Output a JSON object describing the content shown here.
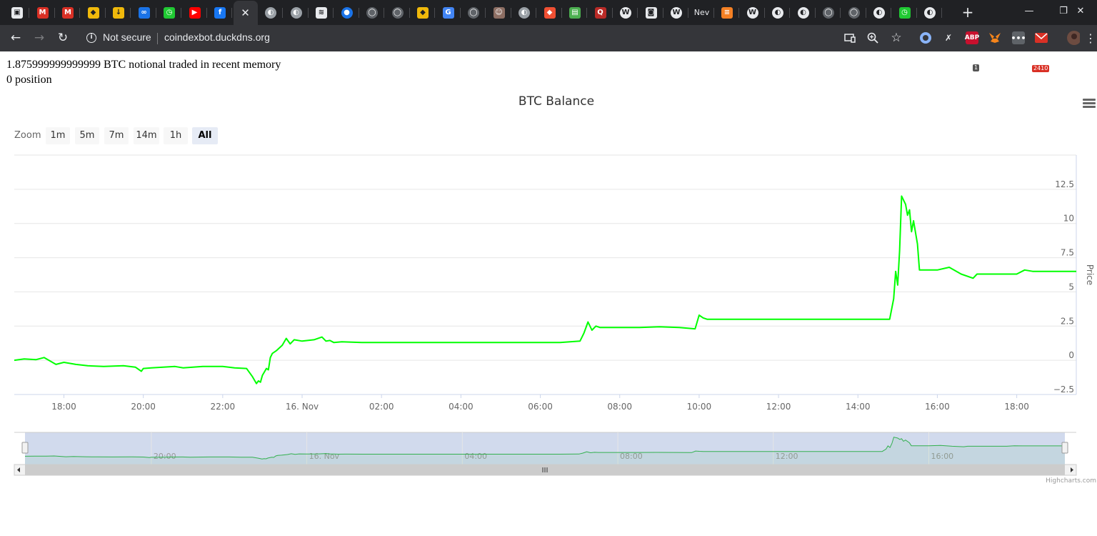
{
  "browser": {
    "tabs": [
      {
        "icon": "generic-site-icon",
        "color": "#e8eaed"
      },
      {
        "icon": "gmail-icon",
        "color": "#d93025"
      },
      {
        "icon": "gmail-icon",
        "color": "#d93025"
      },
      {
        "icon": "binance-icon",
        "color": "#f0b90b"
      },
      {
        "icon": "download-icon",
        "color": "#f0b90b"
      },
      {
        "icon": "link-icon",
        "color": "#1a73e8"
      },
      {
        "icon": "clock-icon",
        "color": "#20c933"
      },
      {
        "icon": "youtube-icon",
        "color": "#ff0000"
      },
      {
        "icon": "facebook-icon",
        "color": "#1877f2"
      },
      {
        "icon": "close-icon",
        "color": "#e8eaed",
        "active": true
      },
      {
        "icon": "globe-icon",
        "color": "#9aa0a6"
      },
      {
        "icon": "globe-icon",
        "color": "#9aa0a6"
      },
      {
        "icon": "chart-site-icon",
        "color": "#e8eaed"
      },
      {
        "icon": "chat-icon",
        "color": "#1a73e8"
      },
      {
        "icon": "github-icon",
        "color": "#5f6368"
      },
      {
        "icon": "github-icon",
        "color": "#5f6368"
      },
      {
        "icon": "binance-icon",
        "color": "#f0b90b"
      },
      {
        "icon": "google-icon",
        "color": "#4285f4"
      },
      {
        "icon": "github-icon",
        "color": "#5f6368"
      },
      {
        "icon": "avatar-icon",
        "color": "#8d6e63"
      },
      {
        "icon": "globe-icon",
        "color": "#9aa0a6"
      },
      {
        "icon": "git-icon",
        "color": "#f05033"
      },
      {
        "icon": "document-icon",
        "color": "#4caf50"
      },
      {
        "icon": "quora-icon",
        "color": "#b92b27"
      },
      {
        "icon": "wordpress-icon",
        "color": "#e8eaed"
      },
      {
        "icon": "camera-icon",
        "color": "#e8eaed"
      },
      {
        "icon": "wordpress-icon",
        "color": "#e8eaed"
      },
      {
        "icon": "new-tab-text-icon",
        "color": "#e8eaed",
        "text": "Nev"
      },
      {
        "icon": "stack-icon",
        "color": "#f48024"
      },
      {
        "icon": "wordpress-icon",
        "color": "#e8eaed"
      },
      {
        "icon": "globe-icon",
        "color": "#e8eaed"
      },
      {
        "icon": "globe-icon",
        "color": "#e8eaed"
      },
      {
        "icon": "github-icon",
        "color": "#5f6368"
      },
      {
        "icon": "github-icon",
        "color": "#5f6368"
      },
      {
        "icon": "globe-icon",
        "color": "#e8eaed"
      },
      {
        "icon": "clock-icon",
        "color": "#20c933"
      },
      {
        "icon": "globe-icon",
        "color": "#e8eaed"
      }
    ],
    "new_tab": "+",
    "window": {
      "minimize": "—",
      "maximize": "❐",
      "close": "✕"
    },
    "nav": {
      "back": "←",
      "forward": "→",
      "reload": "↻"
    },
    "security_label": "Not secure",
    "url": "coindexbot.duckdns.org",
    "extensions": {
      "abp_badge": "1",
      "mail_badge": "2410"
    }
  },
  "page": {
    "line1": "1.875999999999999 BTC notional traded in recent memory",
    "line2": "0 position"
  },
  "chart_ui": {
    "zoom_label": "Zoom",
    "zoom_buttons": [
      "1m",
      "5m",
      "7m",
      "14m",
      "1h",
      "All"
    ],
    "zoom_selected": "All",
    "navigator_ticks": [
      "20:00",
      "16. Nov",
      "04:00",
      "08:00",
      "12:00",
      "16:00"
    ],
    "credits": "Highcharts.com"
  },
  "chart_data": {
    "type": "line",
    "title": "BTC Balance",
    "ylabel": "Price",
    "xlabel": "",
    "y_ticks": [
      "12.5",
      "10",
      "7.5",
      "5",
      "2.5",
      "0",
      "-2.5"
    ],
    "x_ticks": [
      "18:00",
      "20:00",
      "22:00",
      "16. Nov",
      "02:00",
      "04:00",
      "06:00",
      "08:00",
      "10:00",
      "12:00",
      "14:00",
      "16:00",
      "18:00"
    ],
    "x_range_hours": [
      16.75,
      43.5
    ],
    "ylim": [
      -2.5,
      15
    ],
    "grid": true,
    "legend": "none",
    "series": [
      {
        "color": "#00ff00",
        "x": [
          16.75,
          17.0,
          17.3,
          17.5,
          17.8,
          18.0,
          18.3,
          18.6,
          19.0,
          19.5,
          19.8,
          19.95,
          20.0,
          20.2,
          20.5,
          20.8,
          21.0,
          21.5,
          22.0,
          22.3,
          22.6,
          22.75,
          22.85,
          22.9,
          22.95,
          23.0,
          23.1,
          23.15,
          23.2,
          23.25,
          23.35,
          23.5,
          23.6,
          23.7,
          23.8,
          24.0,
          24.3,
          24.5,
          24.6,
          24.7,
          24.8,
          25.0,
          25.5,
          26.0,
          26.5,
          27.0,
          27.5,
          28.0,
          28.5,
          29.0,
          29.5,
          30.0,
          30.5,
          31.0,
          31.1,
          31.2,
          31.3,
          31.4,
          31.5,
          31.7,
          32.0,
          32.5,
          33.0,
          33.5,
          33.9,
          34.0,
          34.1,
          34.2,
          34.5,
          35.0,
          35.5,
          36.0,
          36.5,
          37.0,
          37.5,
          38.0,
          38.5,
          38.8,
          38.9,
          38.95,
          39.0,
          39.05,
          39.1,
          39.2,
          39.25,
          39.3,
          39.35,
          39.4,
          39.5,
          39.55,
          39.6,
          39.7,
          40.0,
          40.3,
          40.6,
          40.9,
          41.0,
          41.5,
          42.0,
          42.2,
          42.4,
          42.6,
          43.0,
          43.5
        ],
        "y": [
          0.0,
          0.1,
          0.05,
          0.2,
          -0.3,
          -0.15,
          -0.3,
          -0.4,
          -0.45,
          -0.4,
          -0.5,
          -0.8,
          -0.6,
          -0.55,
          -0.5,
          -0.45,
          -0.55,
          -0.45,
          -0.45,
          -0.55,
          -0.6,
          -1.2,
          -1.7,
          -1.5,
          -1.6,
          -1.1,
          -0.6,
          -0.7,
          0.2,
          0.5,
          0.7,
          1.1,
          1.6,
          1.2,
          1.5,
          1.4,
          1.5,
          1.7,
          1.4,
          1.45,
          1.3,
          1.35,
          1.3,
          1.3,
          1.3,
          1.3,
          1.3,
          1.3,
          1.3,
          1.3,
          1.3,
          1.3,
          1.3,
          1.4,
          2.0,
          2.8,
          2.2,
          2.5,
          2.4,
          2.4,
          2.4,
          2.4,
          2.45,
          2.4,
          2.3,
          3.3,
          3.1,
          3.0,
          3.0,
          3.0,
          3.0,
          3.0,
          3.0,
          3.0,
          3.0,
          3.0,
          3.0,
          3.0,
          4.5,
          6.5,
          5.5,
          8.0,
          12.0,
          11.4,
          10.6,
          11.0,
          9.4,
          10.2,
          8.5,
          6.6,
          6.6,
          6.6,
          6.6,
          6.8,
          6.3,
          6.0,
          6.3,
          6.3,
          6.3,
          6.6,
          6.5,
          6.5,
          6.5,
          6.5
        ]
      }
    ]
  }
}
